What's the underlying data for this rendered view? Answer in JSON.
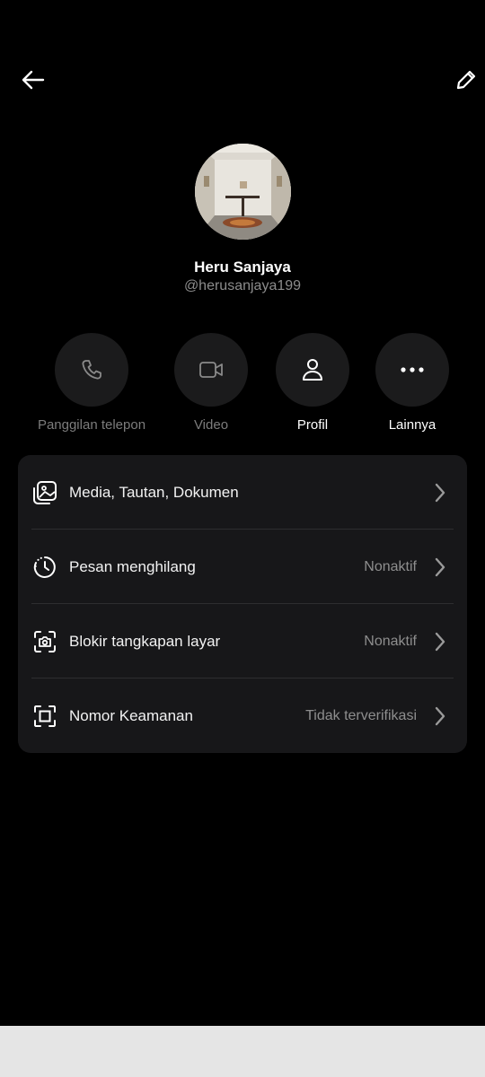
{
  "header": {
    "back_icon": "arrow-left-icon",
    "edit_icon": "pencil-icon"
  },
  "profile": {
    "name": "Heru Sanjaya",
    "handle": "@herusanjaya199"
  },
  "actions": [
    {
      "label": "Panggilan telepon",
      "icon": "phone-icon",
      "enabled": false
    },
    {
      "label": "Video",
      "icon": "video-camera-icon",
      "enabled": false
    },
    {
      "label": "Profil",
      "icon": "person-icon",
      "enabled": true
    },
    {
      "label": "Lainnya",
      "icon": "more-dots-icon",
      "enabled": true
    }
  ],
  "settings": [
    {
      "label": "Media, Tautan, Dokumen",
      "value": "",
      "icon": "media-gallery-icon"
    },
    {
      "label": "Pesan menghilang",
      "value": "Nonaktif",
      "icon": "timer-icon"
    },
    {
      "label": "Blokir tangkapan layar",
      "value": "Nonaktif",
      "icon": "screenshot-camera-icon"
    },
    {
      "label": "Nomor Keamanan",
      "value": "Tidak terverifikasi",
      "icon": "security-number-icon"
    }
  ],
  "colors": {
    "background": "#000000",
    "card": "#171719",
    "action_circle": "#1b1b1c",
    "secondary_text": "#8e8e8e"
  }
}
